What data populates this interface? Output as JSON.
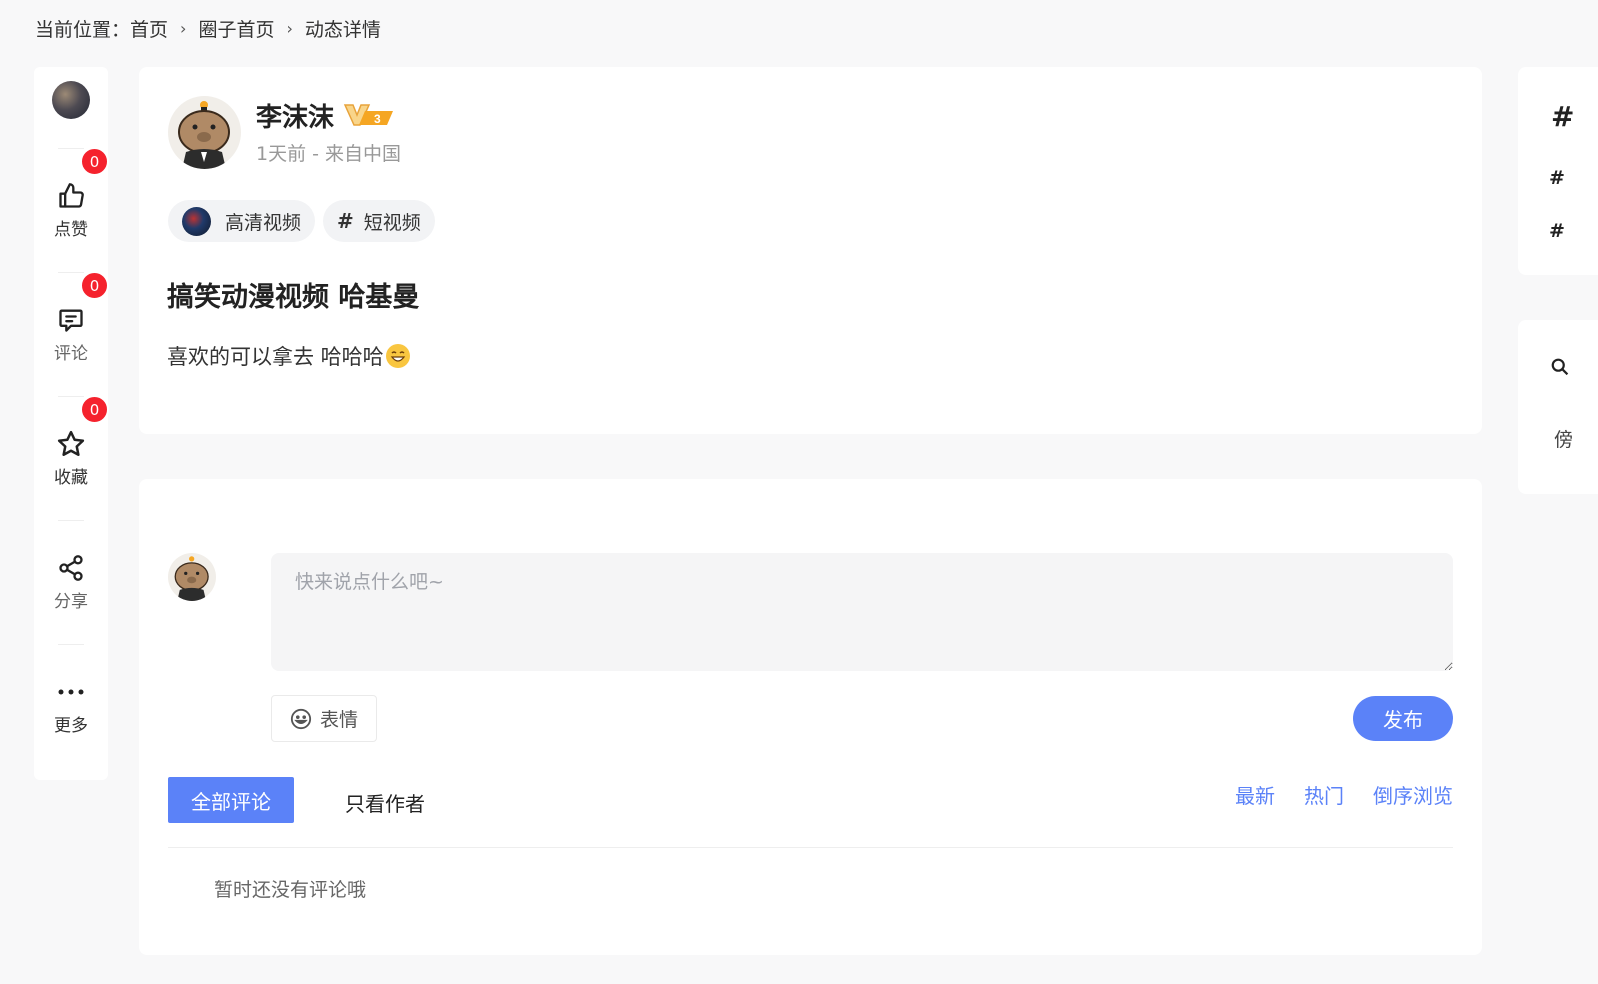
{
  "breadcrumb": {
    "prefix": "当前位置：",
    "items": [
      "首页",
      "圈子首页",
      "动态详情"
    ]
  },
  "rail": {
    "like": {
      "label": "点赞",
      "count": "0"
    },
    "comment": {
      "label": "评论",
      "count": "0"
    },
    "favorite": {
      "label": "收藏",
      "count": "0"
    },
    "share": {
      "label": "分享"
    },
    "more": {
      "label": "更多"
    }
  },
  "post": {
    "author": "李沫沫",
    "vip_level": "3",
    "meta": "1天前 - 来自中国",
    "tags": [
      {
        "label": "高清视频",
        "icon": "circle-image"
      },
      {
        "label": "短视频",
        "icon": "hash-icon"
      }
    ],
    "title": "搞笑动漫视频 哈基曼",
    "body": "喜欢的可以拿去 哈哈哈"
  },
  "comments": {
    "placeholder": "快来说点什么吧~",
    "emoji_label": "表情",
    "publish_label": "发布",
    "tab_all": "全部评论",
    "tab_author": "只看作者",
    "sort_latest": "最新",
    "sort_hot": "热门",
    "sort_reverse": "倒序浏览",
    "empty": "暂时还没有评论哦"
  },
  "side": {
    "hash1": "#",
    "hash2": "#",
    "hash3": "#",
    "partial_char": "傍"
  },
  "colors": {
    "accent": "#5b82f8",
    "badge": "#f5222d",
    "vip": "#f5a623"
  }
}
